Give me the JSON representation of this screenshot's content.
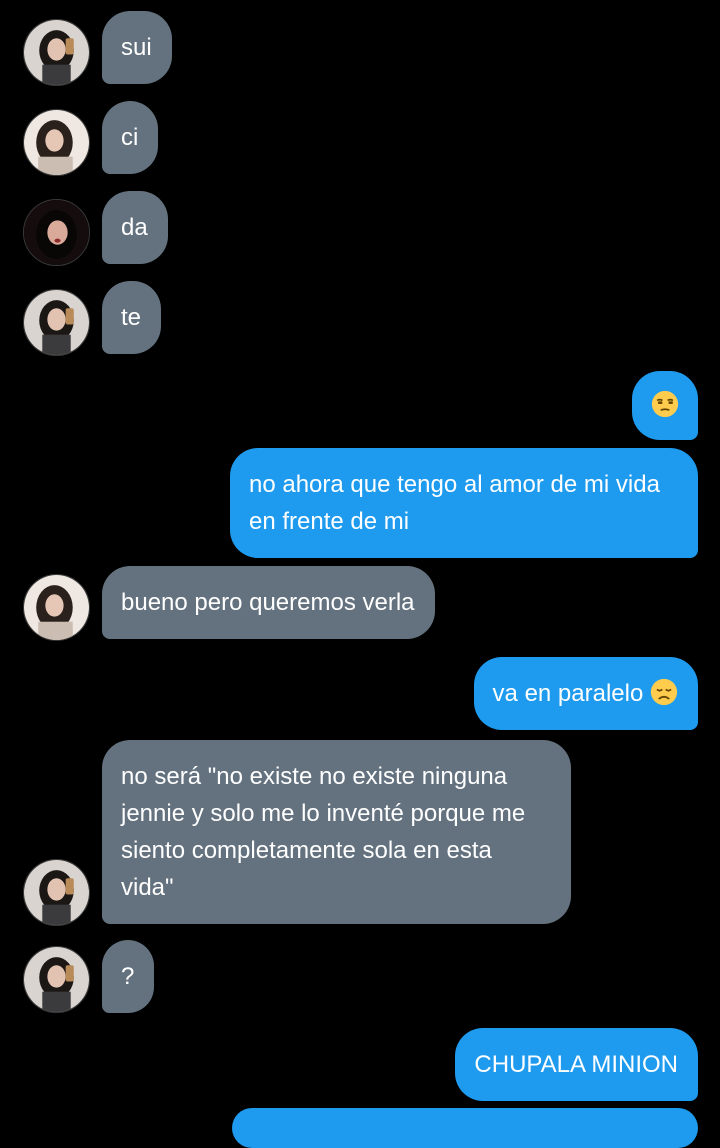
{
  "thread": {
    "messages": [
      {
        "from": "other",
        "text": "sui"
      },
      {
        "from": "other",
        "text": "ci"
      },
      {
        "from": "other",
        "text": "da"
      },
      {
        "from": "other",
        "text": "te"
      },
      {
        "from": "me",
        "text": "",
        "emoji": "unamused-face-emoji"
      },
      {
        "from": "me",
        "text": "no ahora que tengo al amor de mi vida en frente de mi"
      },
      {
        "from": "other",
        "text": "bueno pero queremos verla"
      },
      {
        "from": "me",
        "text": "va en paralelo",
        "emoji": "disappointed-face-emoji"
      },
      {
        "from": "other",
        "text": "no será \"no existe no existe ninguna jennie y solo me lo inventé porque me siento completamente sola en esta vida\""
      },
      {
        "from": "other",
        "text": "?"
      },
      {
        "from": "me",
        "text": "CHUPALA MINION"
      }
    ]
  },
  "colors": {
    "background": "#000000",
    "incoming_bubble": "#64727f",
    "outgoing_bubble": "#1e9bef",
    "text": "#ffffff"
  }
}
